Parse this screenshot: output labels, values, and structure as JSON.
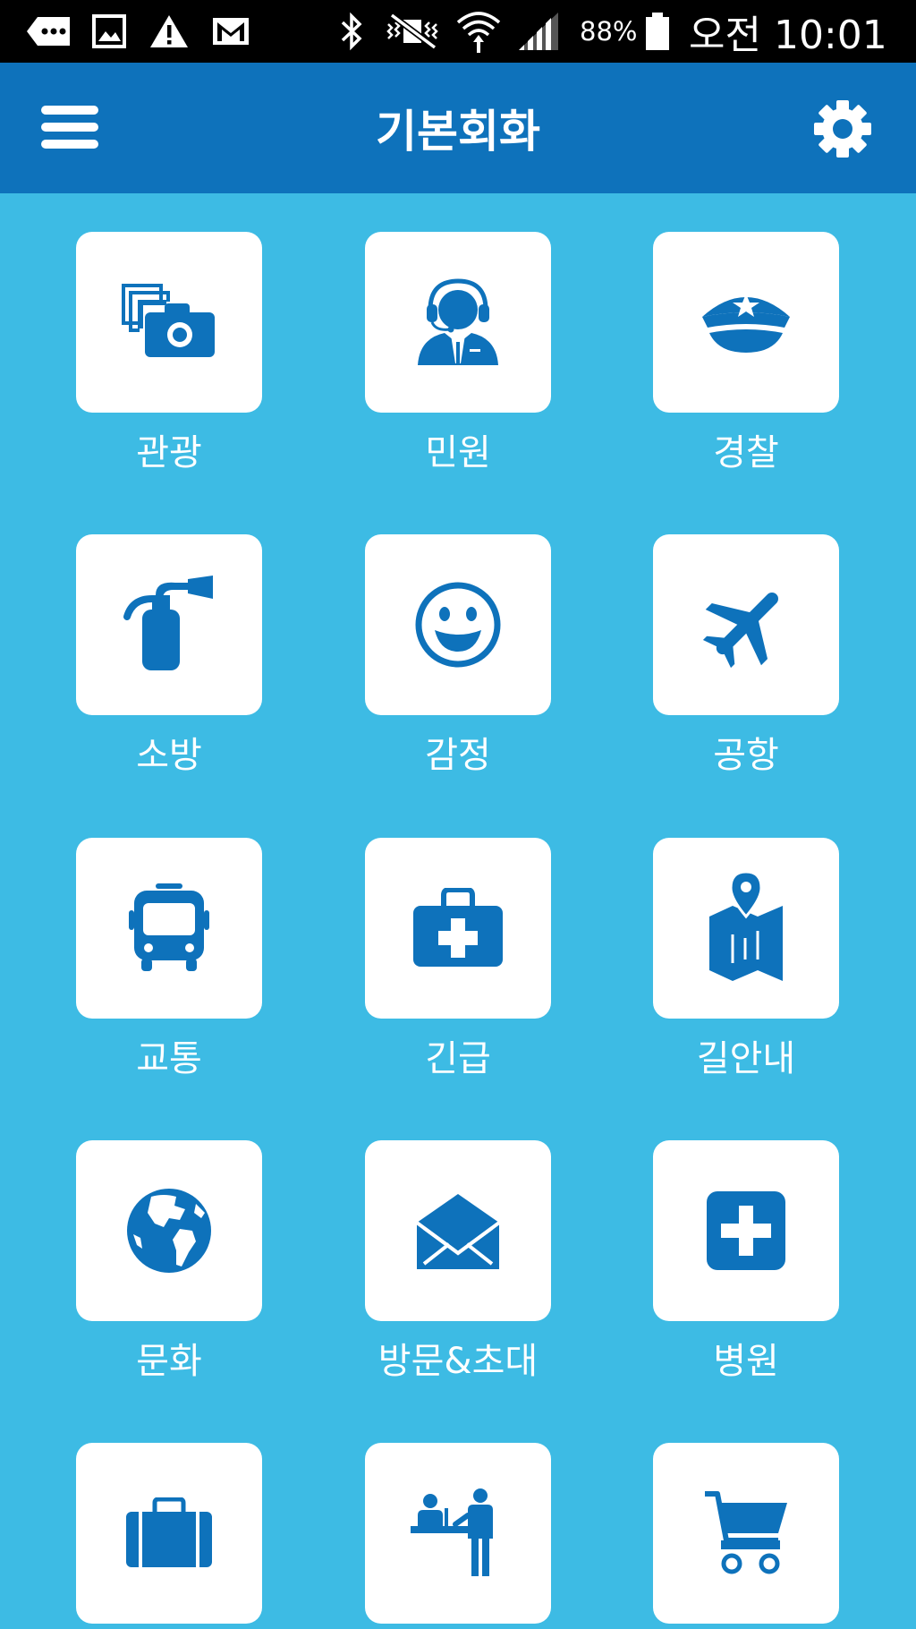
{
  "status_bar": {
    "battery": "88%",
    "time": "오전 10:01"
  },
  "app_bar": {
    "title": "기본회화"
  },
  "categories": [
    {
      "label": "관광",
      "icon": "camera-photos-icon"
    },
    {
      "label": "민원",
      "icon": "customer-service-headset-icon"
    },
    {
      "label": "경찰",
      "icon": "police-hat-icon"
    },
    {
      "label": "소방",
      "icon": "fire-extinguisher-icon"
    },
    {
      "label": "감정",
      "icon": "smiley-face-icon"
    },
    {
      "label": "공항",
      "icon": "airplane-icon"
    },
    {
      "label": "교통",
      "icon": "bus-icon"
    },
    {
      "label": "긴급",
      "icon": "first-aid-kit-icon"
    },
    {
      "label": "길안내",
      "icon": "map-pin-icon"
    },
    {
      "label": "문화",
      "icon": "globe-icon"
    },
    {
      "label": "방문&초대",
      "icon": "envelope-icon"
    },
    {
      "label": "병원",
      "icon": "medical-cross-icon"
    },
    {
      "label": "",
      "icon": "suitcase-icon"
    },
    {
      "label": "",
      "icon": "reception-desk-icon"
    },
    {
      "label": "",
      "icon": "shopping-cart-icon"
    }
  ],
  "colors": {
    "background": "#3dbbe4",
    "app_bar": "#0e72bb",
    "icon": "#0e72bb",
    "card": "#ffffff",
    "status_bar": "#000000"
  }
}
